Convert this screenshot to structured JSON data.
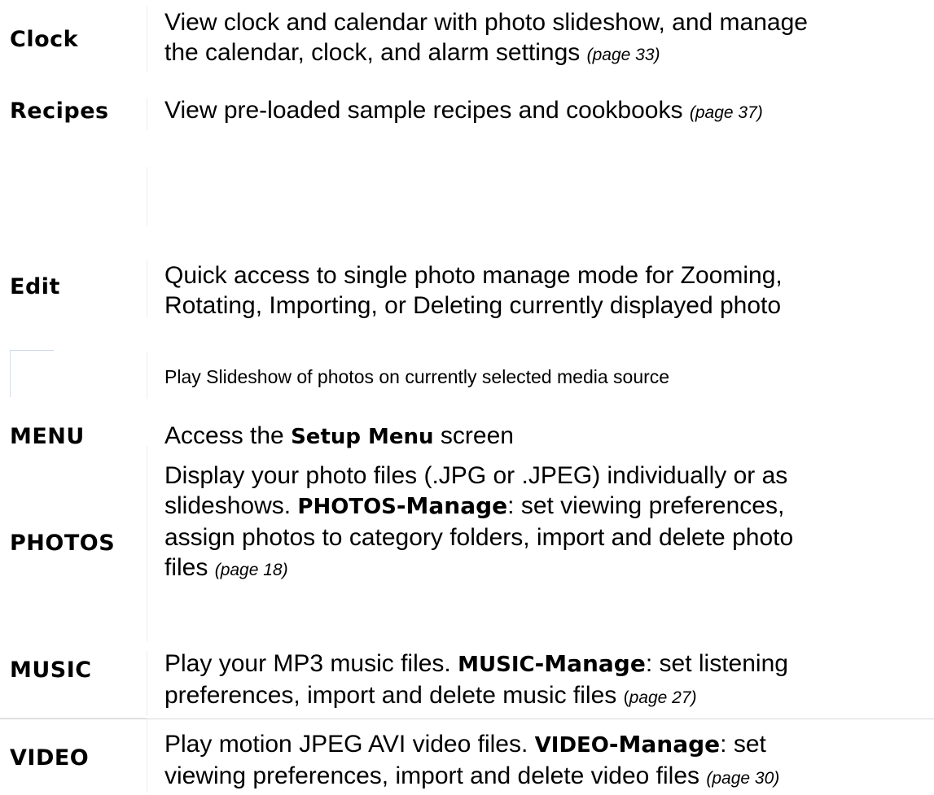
{
  "rows": {
    "clock": {
      "term": "Clock",
      "line1": "View clock and calendar with photo slideshow, and manage",
      "line2": "the calendar, clock, and alarm settings",
      "page": "(page 33)"
    },
    "recipes": {
      "term": "Recipes",
      "text": "View pre-loaded sample recipes and cookbooks",
      "page": "(page 37)"
    },
    "edit": {
      "term": "Edit",
      "line1": "Quick access to single photo manage mode for Zooming,",
      "line2": "Rotating, Importing, or Deleting currently displayed photo"
    },
    "slideshow": {
      "text": "Play Slideshow of photos on currently selected media source"
    },
    "menu": {
      "term": "MENU",
      "text_before": "Access the",
      "bold": "Setup Menu",
      "text_after": "screen"
    },
    "photos": {
      "term": "PHOTOS",
      "line1": "Display your photo files (.JPG or .JPEG) individually or as",
      "line2_before": "slideshows.",
      "line2_term": "PHOTOS",
      "line2_manage": "-Manage",
      "line2_after": ": set viewing preferences,",
      "line3": "assign photos to category folders, import and delete photo",
      "line4": "files",
      "page": "(page 18)"
    },
    "music": {
      "term": "MUSIC",
      "line1_before": "Play your MP3 music files.",
      "line1_term": "MUSIC",
      "line1_manage": "-Manage",
      "line1_after": ": set listening",
      "line2": "preferences, import and delete music files",
      "page_open": "(",
      "page": "page 27)"
    },
    "video": {
      "term": "VIDEO",
      "line1_before": "Play motion JPEG AVI video files.",
      "line1_term": "VIDEO",
      "line1_manage": "-Manage",
      "line1_after": ": set",
      "line2": "viewing preferences, import and delete video files",
      "page": "(page 30)"
    }
  }
}
